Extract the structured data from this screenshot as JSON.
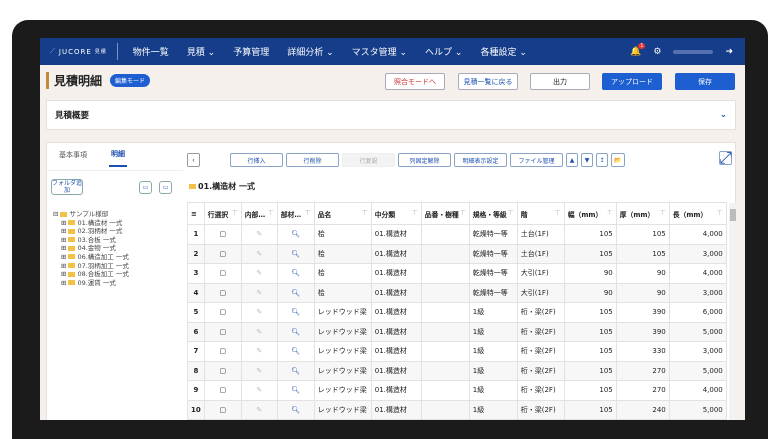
{
  "nav": {
    "logo": "JUCORE",
    "logo_sub": "見積",
    "items": [
      "物件一覧",
      "見積 ⌄",
      "予算管理",
      "詳細分析 ⌄",
      "マスタ管理 ⌄",
      "ヘルプ ⌄",
      "各種設定 ⌄"
    ],
    "notif_count": "1"
  },
  "header": {
    "title": "見積明細",
    "mode_badge": "編集モード",
    "buttons": {
      "view_mode": "照合モードへ",
      "back": "見積一覧に戻る",
      "output": "出力",
      "upload": "アップロード",
      "save": "保存"
    }
  },
  "summary": {
    "title": "見積概要"
  },
  "tabs": [
    "基本事項",
    "明細"
  ],
  "sidebar": {
    "add_folder": "フォルダ追加",
    "root": "サンプル様邸",
    "folders": [
      "01.構造材 一式",
      "02.羽柄材 一式",
      "03.合板 一式",
      "04.金物 一式",
      "06.構造加工 一式",
      "07.羽柄加工 一式",
      "08.合板加工 一式",
      "09.運賃 一式"
    ]
  },
  "toolbar": {
    "insert": "行挿入",
    "delete": "行削除",
    "copy": "行复設",
    "col_settings": "列固定解除",
    "detail_display": "明細表示設定",
    "file_mgmt": "ファイル管理"
  },
  "breadcrumb": "01.構造材 一式",
  "table": {
    "headers": [
      "≡",
      "行選択",
      "内部…",
      "部材…",
      "品名",
      "中分類",
      "品番・樹種",
      "規格・等級",
      "階",
      "幅（mm）",
      "厚（mm）",
      "長（mm）"
    ],
    "rows": [
      [
        "1",
        "桧",
        "01.構造材",
        "乾燥特一等",
        "土台(1F)",
        "105",
        "105",
        "4,000"
      ],
      [
        "2",
        "桧",
        "01.構造材",
        "乾燥特一等",
        "土台(1F)",
        "105",
        "105",
        "3,000"
      ],
      [
        "3",
        "桧",
        "01.構造材",
        "乾燥特一等",
        "大引(1F)",
        "90",
        "90",
        "4,000"
      ],
      [
        "4",
        "桧",
        "01.構造材",
        "乾燥特一等",
        "大引(1F)",
        "90",
        "90",
        "3,000"
      ],
      [
        "5",
        "レッドウッド梁",
        "01.構造材",
        "1級",
        "桁・梁(2F)",
        "105",
        "390",
        "6,000"
      ],
      [
        "6",
        "レッドウッド梁",
        "01.構造材",
        "1級",
        "桁・梁(2F)",
        "105",
        "390",
        "5,000"
      ],
      [
        "7",
        "レッドウッド梁",
        "01.構造材",
        "1級",
        "桁・梁(2F)",
        "105",
        "330",
        "3,000"
      ],
      [
        "8",
        "レッドウッド梁",
        "01.構造材",
        "1級",
        "桁・梁(2F)",
        "105",
        "270",
        "5,000"
      ],
      [
        "9",
        "レッドウッド梁",
        "01.構造材",
        "1級",
        "桁・梁(2F)",
        "105",
        "270",
        "4,000"
      ],
      [
        "10",
        "レッドウッド梁",
        "01.構造材",
        "1級",
        "桁・梁(2F)",
        "105",
        "240",
        "5,000"
      ]
    ]
  }
}
